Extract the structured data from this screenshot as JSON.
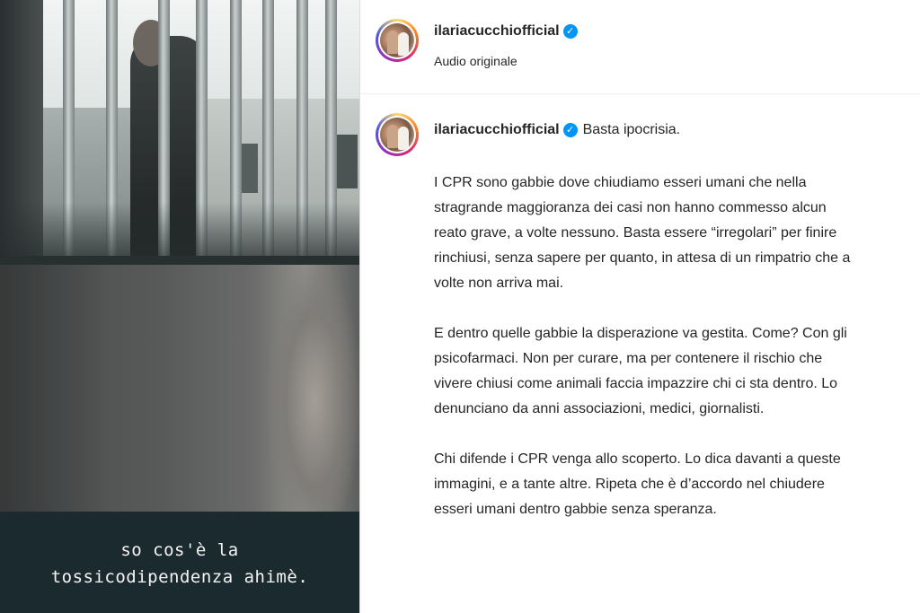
{
  "video": {
    "subtitle_line1": "so cos'è la",
    "subtitle_line2": "tossicodipendenza ahimè."
  },
  "post_header": {
    "username": "ilariacucchiofficial",
    "audio_label": "Audio originale"
  },
  "caption": {
    "username": "ilariacucchiofficial",
    "headline": "Basta ipocrisia.",
    "lines_p1": [
      "I CPR sono gabbie dove chiudiamo esseri umani che nella",
      "stragrande maggioranza dei casi non hanno commesso alcun",
      "reato grave, a volte nessuno. Basta essere “irregolari” per finire",
      "rinchiusi, senza sapere per quanto, in attesa di un rimpatrio che a",
      "volte non arriva mai."
    ],
    "lines_p2": [
      "E dentro quelle gabbie la disperazione va gestita. Come? Con gli",
      "psicofarmaci. Non per curare, ma per contenere il rischio che",
      "vivere chiusi come animali faccia impazzire chi ci sta dentro. Lo",
      "denunciano da anni associazioni, medici, giornalisti."
    ],
    "lines_p3": [
      "Chi difende i CPR venga allo scoperto. Lo dica davanti a queste",
      "immagini, e a tante altre. Ripeta che è d’accordo nel chiudere",
      "esseri umani dentro gabbie senza speranza."
    ]
  },
  "icons": {
    "verified": "verified-badge-icon"
  },
  "colors": {
    "verified_blue": "#0095f6",
    "text": "#262626",
    "subtitle_bg": "#1b2a2e"
  }
}
